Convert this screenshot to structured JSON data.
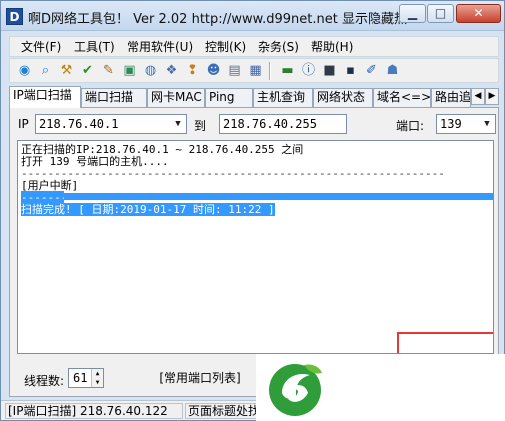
{
  "window": {
    "icon_letter": "D",
    "title": "啊D网络工具包！ Ver 2.02   http://www.d99net.net  显示隐藏热..."
  },
  "window_controls": {
    "minimize": "▁",
    "maximize": "□",
    "close": "✕"
  },
  "menu": {
    "items": [
      {
        "label": "文件(F)"
      },
      {
        "label": "工具(T)"
      },
      {
        "label": "常用软件(U)"
      },
      {
        "label": "控制(K)"
      },
      {
        "label": "杂务(S)"
      },
      {
        "label": "帮助(H)"
      }
    ]
  },
  "toolbar": {
    "buttons": [
      {
        "icon": "globe-go-icon",
        "glyph": "◉",
        "color": "#1d7fd6"
      },
      {
        "icon": "search-icon",
        "glyph": "⌕",
        "color": "#1d7fd6"
      },
      {
        "icon": "tools-icon",
        "glyph": "⚒",
        "color": "#b8860b"
      },
      {
        "icon": "check-icon",
        "glyph": "✔",
        "color": "#2e8b2e"
      },
      {
        "icon": "brush-icon",
        "glyph": "✎",
        "color": "#9c6b2f"
      },
      {
        "icon": "monitor-icon",
        "glyph": "▣",
        "color": "#2e8b57"
      },
      {
        "icon": "globe-icon",
        "glyph": "◍",
        "color": "#3a78b7"
      },
      {
        "icon": "network-icon",
        "glyph": "❖",
        "color": "#4a6fa5"
      },
      {
        "icon": "pin-icon",
        "glyph": "❢",
        "color": "#c77f1a"
      },
      {
        "icon": "user-search-icon",
        "glyph": "☻",
        "color": "#3a6fb7"
      },
      {
        "icon": "computers-icon",
        "glyph": "▤",
        "color": "#5b6f8a"
      },
      {
        "icon": "window-icon",
        "glyph": "▦",
        "color": "#4063a8"
      },
      {
        "icon": "memory-icon",
        "glyph": "▬",
        "color": "#2e7d32"
      },
      {
        "icon": "info-icon",
        "glyph": "ⓘ",
        "color": "#1d5fae"
      },
      {
        "icon": "monitor-dark-icon",
        "glyph": "■",
        "color": "#2f3a48"
      },
      {
        "icon": "terminal-icon",
        "glyph": "▪",
        "color": "#1e3050"
      },
      {
        "icon": "pen-icon",
        "glyph": "✐",
        "color": "#2b5aa6"
      },
      {
        "icon": "group-icon",
        "glyph": "☗",
        "color": "#4a7bbd"
      }
    ]
  },
  "tabs": {
    "items": [
      {
        "label": "IP端口扫描",
        "active": true
      },
      {
        "label": "端口扫描",
        "active": false
      },
      {
        "label": "网卡MAC",
        "active": false
      },
      {
        "label": "Ping",
        "active": false
      },
      {
        "label": "主机查询",
        "active": false
      },
      {
        "label": "网络状态",
        "active": false
      },
      {
        "label": "域名<=>IP",
        "active": false
      },
      {
        "label": "路由追",
        "active": false
      }
    ],
    "nav_left": "◀",
    "nav_right": "▶"
  },
  "scan": {
    "ip_label": "IP",
    "ip_start": "218.76.40.1",
    "to_label": "到",
    "ip_end": "218.76.40.255",
    "port_label": "端口:",
    "port_value": "139"
  },
  "output": {
    "lines": [
      "正在扫描的IP:218.76.40.1 ~ 218.76.40.255 之间",
      "打开 139 号端口的主机....",
      "----------------------------------------------------------------",
      "[用户中断]",
      "----------------------------------------------------------------",
      "扫描完成! [ 日期:2019-01-17 时间: 11:22 ]"
    ]
  },
  "controls": {
    "threads_label": "线程数:",
    "threads_value": "61",
    "common_ports_button": "[常用端口列表]"
  },
  "status": {
    "left": "[IP端口扫描] 218.76.40.122",
    "right": "页面标题处找"
  },
  "colors": {
    "selection": "#3399ff",
    "logo_green": "#2e9d3a",
    "red_box": "#e53935"
  }
}
